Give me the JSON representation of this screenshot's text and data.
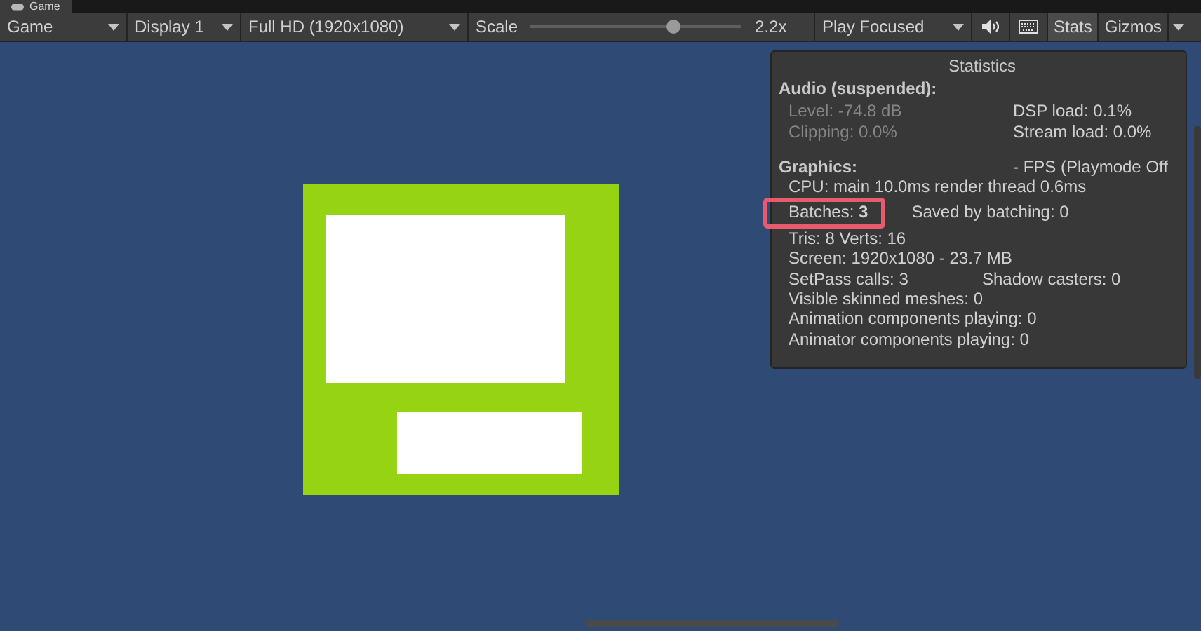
{
  "tab": {
    "label": "Game",
    "selected": true
  },
  "toolbar": {
    "view_dropdown": "Game",
    "display_dropdown": "Display 1",
    "resolution_dropdown": "Full HD (1920x1080)",
    "scale": {
      "label": "Scale",
      "level": 0.68,
      "reading": "2.2x"
    },
    "play_mode_dropdown": "Play Focused",
    "mute_audio": {
      "on": false
    },
    "stats": {
      "label": "Stats",
      "selected": true
    },
    "gizmos": {
      "label": "Gizmos",
      "selected": false
    }
  },
  "statistics": {
    "title": "Statistics",
    "audio": {
      "heading": "Audio (suspended):",
      "rows": [
        {
          "cells": [
            {
              "text": "Level: -74.8 dB",
              "disabled": true
            },
            {
              "text": "DSP load: 0.1%",
              "disabled": false
            }
          ]
        },
        {
          "cells": [
            {
              "text": "Clipping: 0.0%",
              "disabled": true
            },
            {
              "text": "Stream load: 0.0%",
              "disabled": false
            }
          ]
        }
      ]
    },
    "graphics": {
      "heading": "Graphics:",
      "fps": "- FPS (Playmode Off",
      "rows": [
        {
          "cells": [
            "CPU: main 10.0ms  render thread 0.6ms"
          ]
        },
        {
          "cells": [
            "Batches: **3**",
            "Saved by batching: 0"
          ]
        },
        {
          "cells": [
            "Tris: 8  Verts: 16"
          ]
        },
        {
          "cells": [
            "Screen: 1920x1080 - 23.7 MB"
          ]
        },
        {
          "cells": [
            "SetPass calls: 3",
            "Shadow casters: 0"
          ]
        },
        {
          "cells": [
            "Visible skinned meshes: 0"
          ]
        },
        {
          "cells": [
            "Animation components playing: 0"
          ]
        },
        {
          "cells": [
            "Animator components playing: 0"
          ]
        }
      ]
    }
  }
}
